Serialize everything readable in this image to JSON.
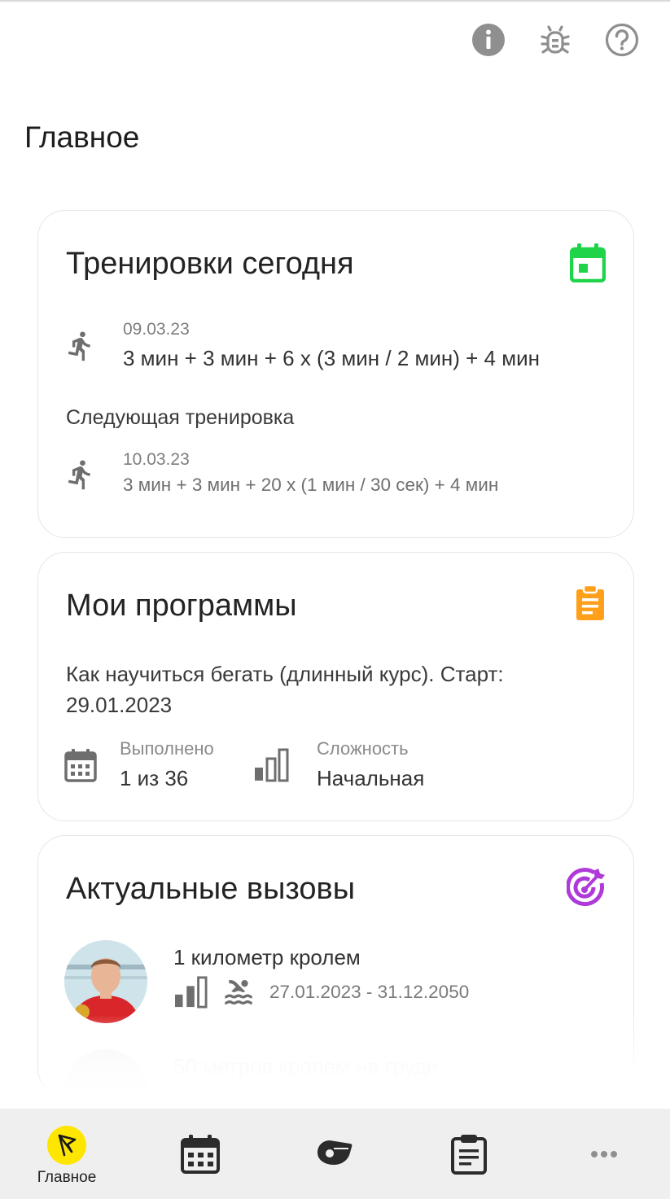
{
  "page": {
    "title": "Главное"
  },
  "top_icons": [
    "info-icon",
    "bug-icon",
    "help-icon"
  ],
  "colors": {
    "green": "#20d44a",
    "orange": "#ff9f1a",
    "purple": "#b03ad9",
    "yellow": "#ffe600",
    "nav_bg": "#efefef"
  },
  "trainings": {
    "title": "Тренировки сегодня",
    "today": {
      "date": "09.03.23",
      "description": "3 мин + 3 мин + 6 х (3 мин / 2 мин) + 4 мин"
    },
    "next_label": "Следующая тренировка",
    "next": {
      "date": "10.03.23",
      "description": "3 мин + 3 мин + 20 х (1 мин / 30 сек) + 4 мин"
    }
  },
  "programs": {
    "title": "Мои программы",
    "program_name": "Как научиться бегать (длинный курс). Старт: 29.01.2023",
    "done_label": "Выполнено",
    "done_value": "1 из 36",
    "level_label": "Сложность",
    "level_value": "Начальная"
  },
  "challenges": {
    "title": "Актуальные вызовы",
    "items": [
      {
        "title": "1 километр кролем",
        "dates": "27.01.2023 - 31.12.2050",
        "sport_icon": "swimming-icon"
      },
      {
        "title": "50 метров кролем на груди"
      }
    ]
  },
  "bottom_nav": {
    "items": [
      {
        "label": "Главное",
        "icon": "home-flag-icon",
        "active": true
      },
      {
        "icon": "calendar-icon"
      },
      {
        "icon": "whistle-icon"
      },
      {
        "icon": "clipboard-icon"
      },
      {
        "icon": "more-icon"
      }
    ]
  }
}
